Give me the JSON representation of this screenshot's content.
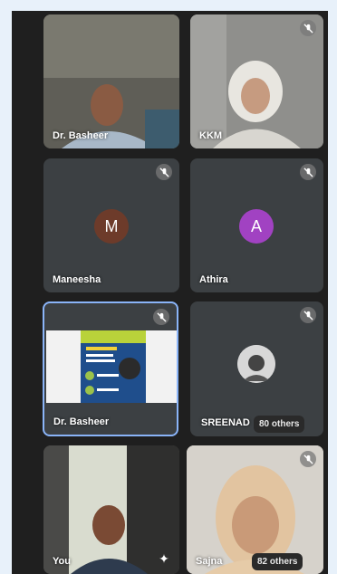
{
  "participants": [
    {
      "name": "Dr. Basheer",
      "type": "video"
    },
    {
      "name": "KKM",
      "type": "video"
    },
    {
      "name": "Maneesha",
      "type": "avatar",
      "initial": "M",
      "avatar_color": "#6d3b2a"
    },
    {
      "name": "Athira",
      "type": "avatar",
      "initial": "A",
      "avatar_color": "#a142c2"
    },
    {
      "name": "Dr. Basheer",
      "type": "screenshare",
      "highlighted": true
    },
    {
      "name": "SREENAD",
      "type": "avatar-photo",
      "others_label": "80 others"
    },
    {
      "name": "You",
      "type": "video"
    },
    {
      "name": "Sajna",
      "type": "video",
      "others_label": "82 others"
    }
  ],
  "colors": {
    "background": "#1f1f1f",
    "tile": "#3c4043",
    "highlight_border": "#8ab4f8",
    "page_bg": "#e8f1fa"
  },
  "icons": {
    "mute": "mic-off-icon",
    "effects": "sparkle-icon"
  }
}
